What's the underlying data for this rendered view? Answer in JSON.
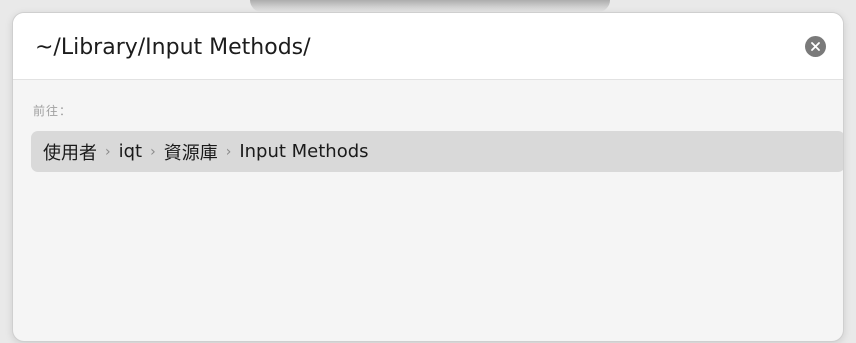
{
  "path_bar": {
    "value": "~/Library/Input Methods/",
    "clear_icon": "xmark-circle-icon"
  },
  "goto_label": "前往：",
  "suggestion": {
    "segments": [
      "使用者",
      "iqt",
      "資源庫",
      "Input Methods"
    ],
    "separator": "›"
  },
  "colors": {
    "highlight": "#d9d9d9",
    "panel_bg": "#f5f5f5",
    "input_bg": "#ffffff"
  }
}
